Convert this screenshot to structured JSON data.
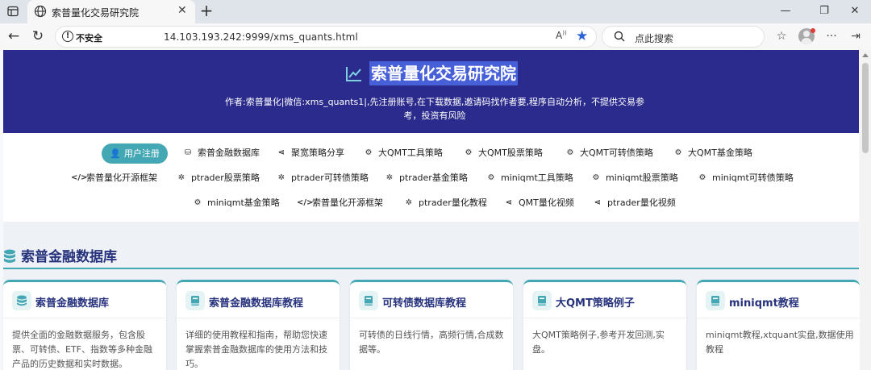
{
  "browser": {
    "tab_title": "索普量化交易研究院",
    "security_label": "不安全",
    "url": "14.103.193.242:9999/xms_quants.html",
    "search_placeholder": "点此搜索",
    "accent": "#2b63d6"
  },
  "hero": {
    "title": "索普量化交易研究院",
    "subtitle": "作者:索普量化|微信:xms_quants1|,先注册账号,在下载数据,邀请码找作者要,程序自动分析，不提供交易参考，投资有风险",
    "bg_color": "#2a2b8c"
  },
  "nav": {
    "register": "用户注册",
    "row1": [
      {
        "icon": "database-icon",
        "label": "索普金融数据库"
      },
      {
        "icon": "share-icon",
        "label": "聚宽策略分享"
      },
      {
        "icon": "gears-icon",
        "label": "大QMT工具策略"
      },
      {
        "icon": "gears-icon",
        "label": "大QMT股票策略"
      },
      {
        "icon": "gears-icon",
        "label": "大QMT可转债策略"
      },
      {
        "icon": "gears-icon",
        "label": "大QMT基金策略"
      }
    ],
    "row2": [
      {
        "icon": "code-icon",
        "label": "索普量化开源框架"
      },
      {
        "icon": "chip-icon",
        "label": "ptrader股票策略"
      },
      {
        "icon": "chip-icon",
        "label": "ptrader可转债策略"
      },
      {
        "icon": "chip-icon",
        "label": "ptrader基金策略"
      },
      {
        "icon": "gears-icon",
        "label": "miniqmt工具策略"
      },
      {
        "icon": "gears-icon",
        "label": "miniqmt股票策略"
      },
      {
        "icon": "gears-icon",
        "label": "miniqmt可转债策略"
      }
    ],
    "row3": [
      {
        "icon": "gears-icon",
        "label": "miniqmt基金策略"
      },
      {
        "icon": "code-icon",
        "label": "索普量化开源框架"
      },
      {
        "icon": "chip-icon",
        "label": "ptrader量化教程"
      },
      {
        "icon": "share-icon",
        "label": "QMT量化视频"
      },
      {
        "icon": "share-icon",
        "label": "ptrader量化视频"
      }
    ],
    "button_color": "#43a8b4"
  },
  "section": {
    "title": "索普金融数据库",
    "cards": [
      {
        "icon": "database-icon",
        "title": "索普金融数据库",
        "desc": "提供全面的金融数据服务，包含股票、可转债、ETF、指数等多种金融产品的历史数据和实时数据。"
      },
      {
        "icon": "book-icon",
        "title": "索普金融数据库教程",
        "desc": "详细的使用教程和指南，帮助您快速掌握索普金融数据库的使用方法和技巧。"
      },
      {
        "icon": "book-icon",
        "title": "可转债数据库教程",
        "desc": "可转债的日线行情，高频行情,合成数据等。"
      },
      {
        "icon": "book-icon",
        "title": "大QMT策略例子",
        "desc": "大QMT策略例子,参考开发回测,实盘。"
      },
      {
        "icon": "book-icon",
        "title": "miniqmt教程",
        "desc": "miniqmt教程,xtquant实盘,数据使用教程"
      }
    ]
  }
}
